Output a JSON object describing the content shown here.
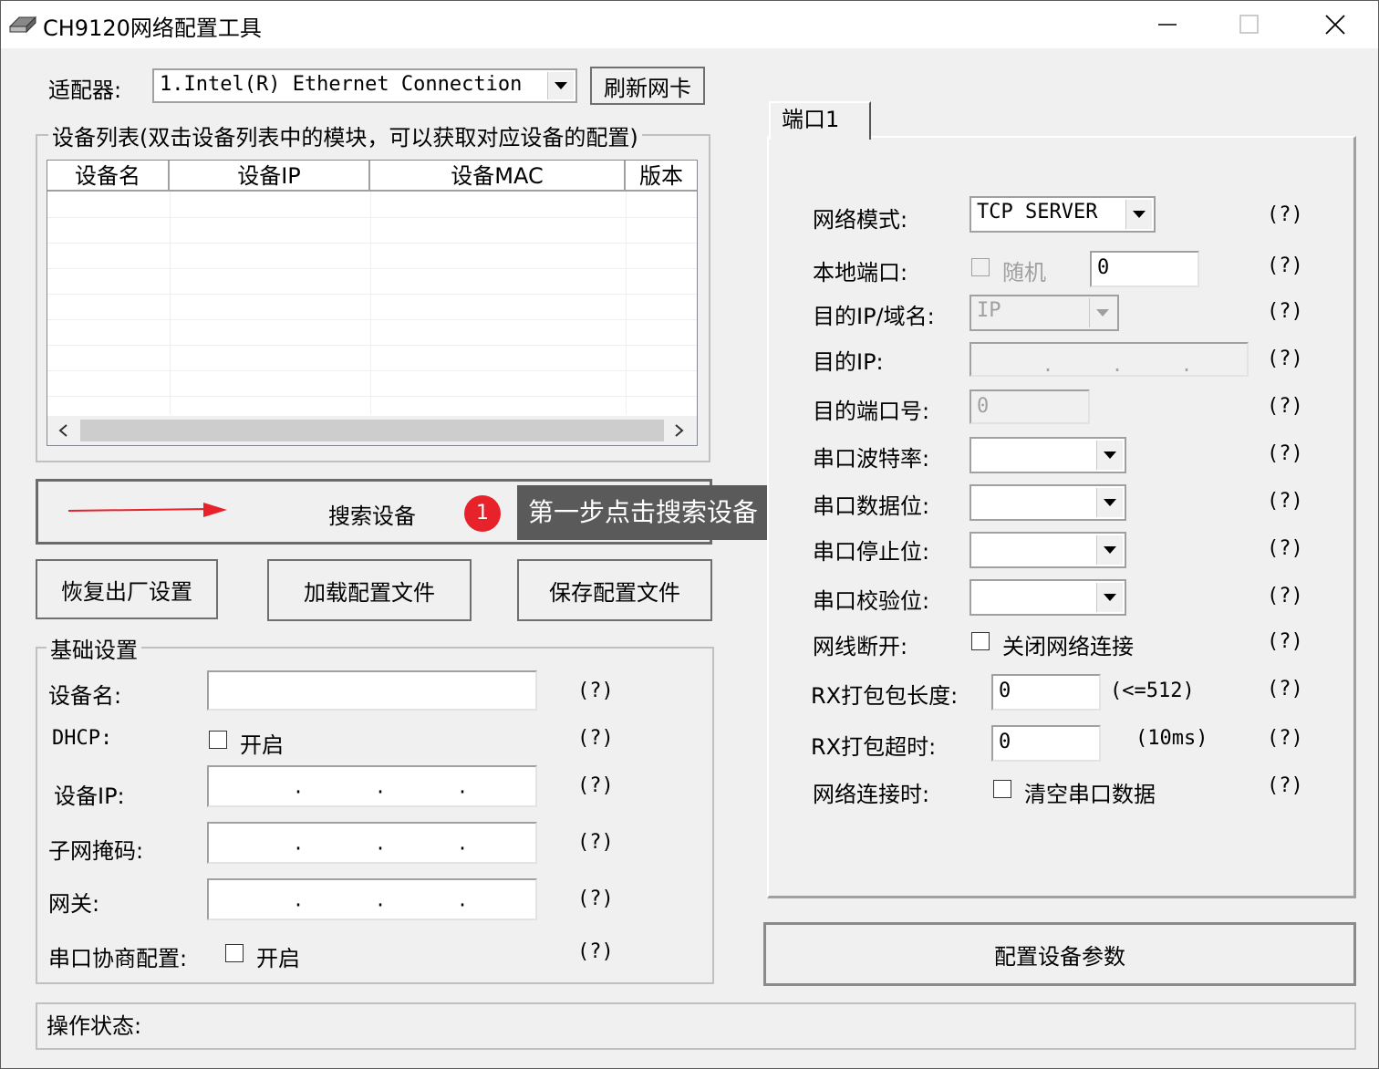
{
  "window": {
    "title": "CH9120网络配置工具"
  },
  "adapter": {
    "label": "适配器:",
    "value": "1.Intel(R) Ethernet Connection",
    "refresh_label": "刷新网卡"
  },
  "device_list": {
    "group_title": "设备列表(双击设备列表中的模块，可以获取对应设备的配置)",
    "columns": [
      "设备名",
      "设备IP",
      "设备MAC",
      "版本"
    ]
  },
  "search": {
    "button_label": "搜索设备",
    "step_number": "1",
    "tooltip": "第一步点击搜索设备"
  },
  "buttons": {
    "factory_reset": "恢复出厂设置",
    "load_config": "加载配置文件",
    "save_config": "保存配置文件",
    "configure": "配置设备参数"
  },
  "basic": {
    "group_title": "基础设置",
    "device_name_label": "设备名:",
    "dhcp_label": "DHCP:",
    "dhcp_check_label": "开启",
    "device_ip_label": "设备IP:",
    "subnet_label": "子网掩码:",
    "gateway_label": "网关:",
    "serial_negotiation_label": "串口协商配置:",
    "serial_negotiation_check_label": "开启",
    "help": "(?)"
  },
  "port_tab": {
    "tab_label": "端口1",
    "network_mode_label": "网络模式:",
    "network_mode_value": "TCP SERVER",
    "local_port_label": "本地端口:",
    "random_label": "随机",
    "local_port_value": "0",
    "dest_ip_domain_label": "目的IP/域名:",
    "dest_ip_domain_value": "IP",
    "dest_ip_label": "目的IP:",
    "dest_port_label": "目的端口号:",
    "dest_port_value": "0",
    "baud_label": "串口波特率:",
    "data_bits_label": "串口数据位:",
    "stop_bits_label": "串口停止位:",
    "parity_label": "串口校验位:",
    "cable_disconnect_label": "网线断开:",
    "close_conn_label": "关闭网络连接",
    "rx_len_label": "RX打包包长度:",
    "rx_len_value": "0",
    "rx_len_hint": "(<=512)",
    "rx_timeout_label": "RX打包超时:",
    "rx_timeout_value": "0",
    "rx_timeout_hint": "(10ms)",
    "on_connect_label": "网络连接时:",
    "clear_serial_label": "清空串口数据",
    "help": "(?)"
  },
  "status": {
    "label": "操作状态:"
  },
  "colors": {
    "badge": "#e8222a",
    "arrow": "#e8222a",
    "tooltip_bg": "#5a5a5a"
  }
}
